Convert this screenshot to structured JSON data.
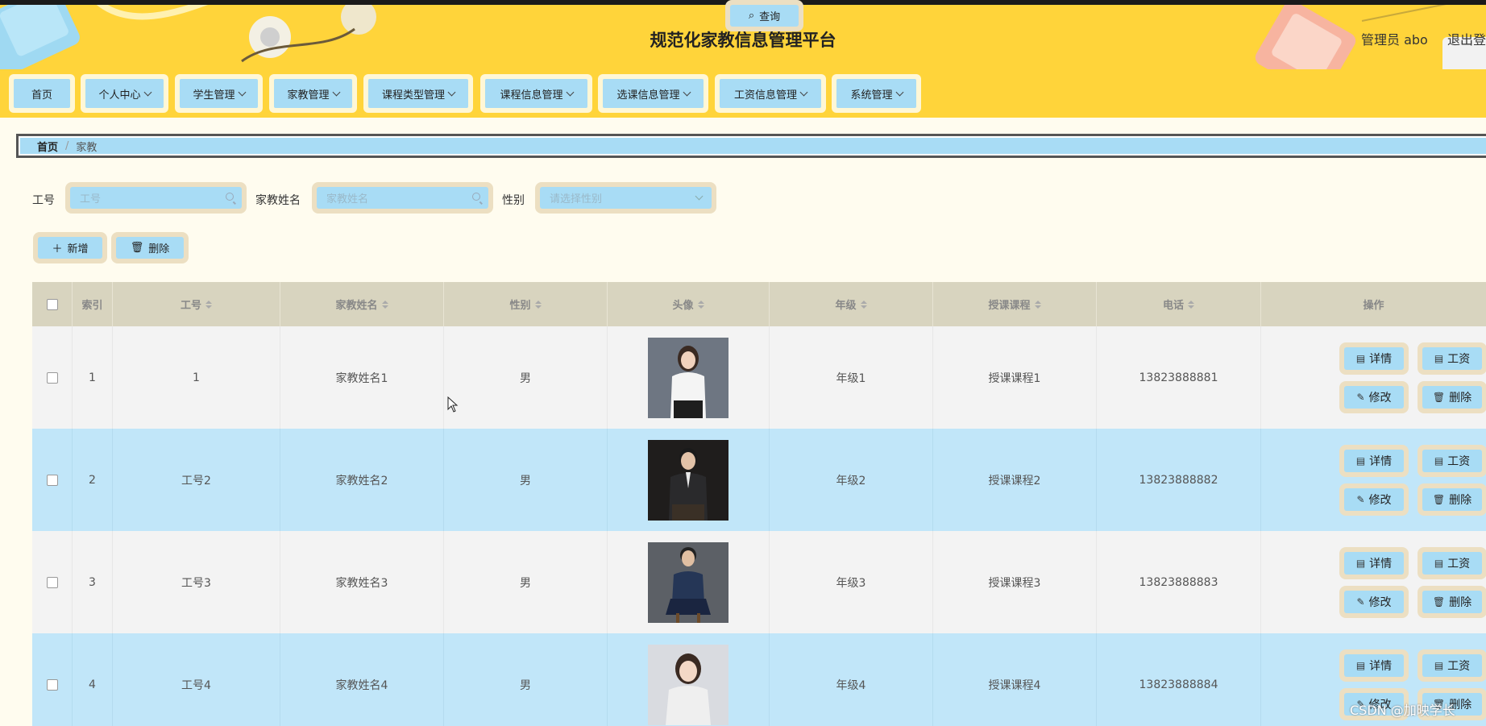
{
  "header": {
    "title": "规范化家教信息管理平台",
    "admin": "管理员 abo",
    "logout": "退出登录"
  },
  "nav": [
    {
      "label": "首页",
      "has_menu": false
    },
    {
      "label": "个人中心",
      "has_menu": true
    },
    {
      "label": "学生管理",
      "has_menu": true
    },
    {
      "label": "家教管理",
      "has_menu": true
    },
    {
      "label": "课程类型管理",
      "has_menu": true
    },
    {
      "label": "课程信息管理",
      "has_menu": true
    },
    {
      "label": "选课信息管理",
      "has_menu": true
    },
    {
      "label": "工资信息管理",
      "has_menu": true
    },
    {
      "label": "系统管理",
      "has_menu": true
    }
  ],
  "breadcrumb": {
    "home": "首页",
    "separator": "/",
    "current": "家教"
  },
  "search": {
    "id_label": "工号",
    "id_placeholder": "工号",
    "name_label": "家教姓名",
    "name_placeholder": "家教姓名",
    "gender_label": "性别",
    "gender_placeholder": "请选择性别",
    "query_label": "查询"
  },
  "actions": {
    "add_label": "新增",
    "delete_label": "删除"
  },
  "table": {
    "headers": {
      "index": "索引",
      "id": "工号",
      "name": "家教姓名",
      "gender": "性别",
      "avatar": "头像",
      "grade": "年级",
      "course": "授课课程",
      "phone": "电话",
      "ops": "操作"
    },
    "op_labels": {
      "detail": "详情",
      "salary": "工资",
      "edit": "修改",
      "delete": "删除"
    },
    "rows": [
      {
        "index": "1",
        "id": "1",
        "name": "家教姓名1",
        "gender": "男",
        "grade": "年级1",
        "course": "授课课程1",
        "phone": "13823888881",
        "avatar": {
          "bg": "#6e7682",
          "outfit": "#f4f4f4",
          "skirt": "#1e1e1e",
          "hair": "#3a2a22"
        }
      },
      {
        "index": "2",
        "id": "工号2",
        "name": "家教姓名2",
        "gender": "男",
        "grade": "年级2",
        "course": "授课课程2",
        "phone": "13823888882",
        "avatar": {
          "bg": "#1f1d1c",
          "outfit": "#2a2a2c",
          "skirt": "#3a3026",
          "hair": "#1a1a1a"
        }
      },
      {
        "index": "3",
        "id": "工号3",
        "name": "家教姓名3",
        "gender": "男",
        "grade": "年级3",
        "course": "授课课程3",
        "phone": "13823888883",
        "avatar": {
          "bg": "#5c6066",
          "outfit": "#253656",
          "skirt": "#1a2540",
          "hair": "#222222"
        }
      },
      {
        "index": "4",
        "id": "工号4",
        "name": "家教姓名4",
        "gender": "男",
        "grade": "年级4",
        "course": "授课课程4",
        "phone": "13823888884",
        "avatar": {
          "bg": "#d9dbe0",
          "outfit": "#efefef",
          "skirt": "#e4e4e4",
          "hair": "#3a2a22"
        }
      }
    ]
  },
  "watermark": "CSDN @加映学长",
  "colors": {
    "header_bg": "#ffd43a",
    "button_bg": "#a8dcf5",
    "button_border": "#ecdfc2",
    "row_odd": "#f3f3f3",
    "row_even": "#c1e6f9",
    "page_bg": "#fffcef"
  }
}
